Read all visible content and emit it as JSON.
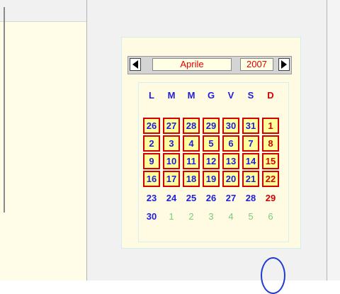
{
  "calendar": {
    "month": "Aprile",
    "year": "2007",
    "weekdays": [
      "L",
      "M",
      "M",
      "G",
      "V",
      "S",
      "D"
    ],
    "weekday_colors": [
      "#1d1ddf",
      "#1d1ddf",
      "#1d1ddf",
      "#1d1ddf",
      "#1d1ddf",
      "#1d1ddf",
      "#d40000"
    ],
    "weeks": [
      [
        "26",
        "27",
        "28",
        "29",
        "30",
        "31",
        "1"
      ],
      [
        "2",
        "3",
        "4",
        "5",
        "6",
        "7",
        "8"
      ],
      [
        "9",
        "10",
        "11",
        "12",
        "13",
        "14",
        "15"
      ],
      [
        "16",
        "17",
        "18",
        "19",
        "20",
        "21",
        "22"
      ],
      [
        "23",
        "24",
        "25",
        "26",
        "27",
        "28",
        "29"
      ],
      [
        "30",
        "1",
        "2",
        "3",
        "4",
        "5",
        "6"
      ]
    ],
    "circled_day": "21",
    "colors": {
      "accent_red": "#d40000",
      "day_blue": "#1d1ddf",
      "next_month_green": "#79cc79",
      "highlight_yellow": "#ffff9c"
    }
  }
}
